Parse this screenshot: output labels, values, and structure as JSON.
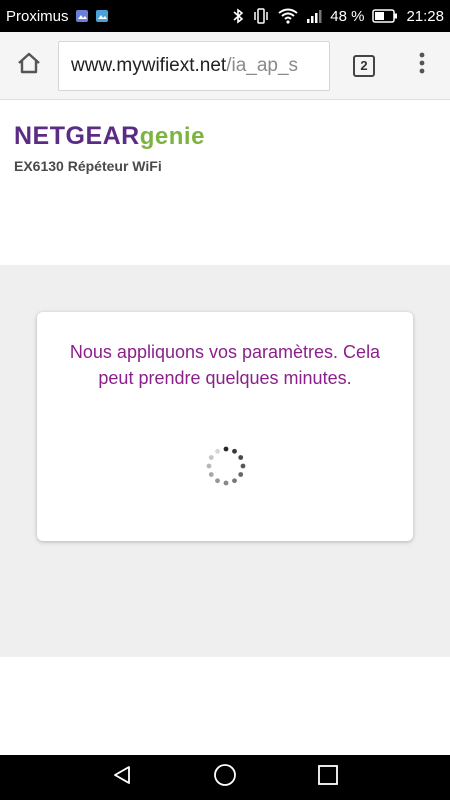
{
  "status_bar": {
    "carrier": "Proximus",
    "battery": "48 %",
    "time": "21:28",
    "icons": [
      "gallery-icon",
      "image-icon",
      "bluetooth-icon",
      "vibrate-icon",
      "wifi-icon",
      "signal-icon",
      "battery-icon"
    ]
  },
  "browser": {
    "url_host": "www.mywifiext.net",
    "url_path": "/ia_ap_s",
    "tab_count": "2",
    "icons": {
      "home": "home-icon",
      "menu": "more-vert-icon"
    }
  },
  "header": {
    "brand": "NETGEAR",
    "product": "genie",
    "model_line": "EX6130 Répéteur WiFi",
    "colors": {
      "brand": "#5b2c83",
      "product": "#7cb342"
    }
  },
  "dialog": {
    "message": "Nous appliquons vos paramètres. Cela peut prendre quelques minutes.",
    "message_color": "#8b1f8c",
    "loading": true
  },
  "navbar": {
    "icons": [
      "back-icon",
      "home-circle-icon",
      "recents-icon"
    ]
  }
}
